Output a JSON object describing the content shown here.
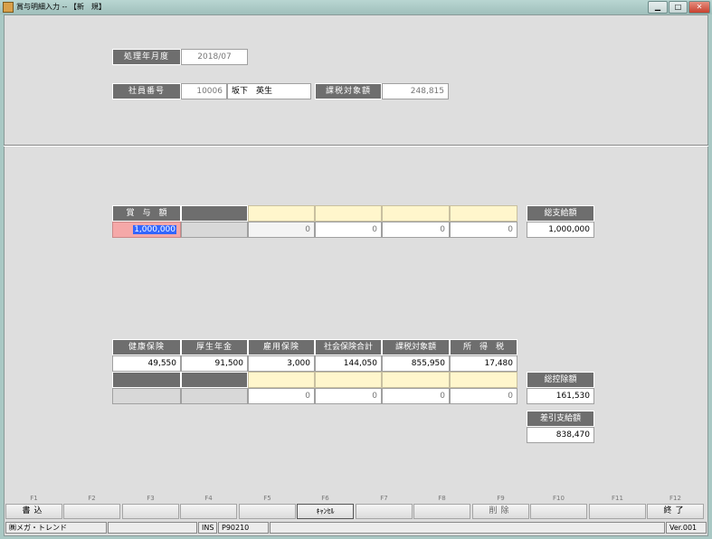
{
  "window": {
    "title": "賞与明細入力 -- 【新　規】"
  },
  "header": {
    "period_label": "処理年月度",
    "period_value": "2018/07",
    "emp_label": "社員番号",
    "emp_no": "10006",
    "emp_name": "坂下　英生",
    "taxable_label": "課税対象額",
    "taxable_value": "248,815"
  },
  "payment": {
    "bonus_label": "賞　与　額",
    "bonus_value": "1,000,000",
    "extra_values": [
      "0",
      "0",
      "0",
      "0"
    ],
    "total_label": "総支給額",
    "total_value": "1,000,000"
  },
  "deduction": {
    "headers": [
      "健康保険",
      "厚生年金",
      "雇用保険",
      "社会保険合計",
      "課税対象額",
      "所　得　税"
    ],
    "values": [
      "49,550",
      "91,500",
      "3,000",
      "144,050",
      "855,950",
      "17,480"
    ],
    "extra_values": [
      "0",
      "0",
      "0",
      "0"
    ],
    "total_label": "総控除額",
    "total_value": "161,530",
    "net_label": "差引支給額",
    "net_value": "838,470"
  },
  "fkeys": [
    {
      "key": "F1",
      "label": "書込"
    },
    {
      "key": "F2",
      "label": ""
    },
    {
      "key": "F3",
      "label": ""
    },
    {
      "key": "F4",
      "label": ""
    },
    {
      "key": "F5",
      "label": ""
    },
    {
      "key": "F6",
      "label": "ｷｬﾝｾﾙ"
    },
    {
      "key": "F7",
      "label": ""
    },
    {
      "key": "F8",
      "label": ""
    },
    {
      "key": "F9",
      "label": "削除"
    },
    {
      "key": "F10",
      "label": ""
    },
    {
      "key": "F11",
      "label": ""
    },
    {
      "key": "F12",
      "label": "終了"
    }
  ],
  "statusbar": {
    "company": "㈱メガ・トレンド",
    "mode": "INS",
    "program": "P90210",
    "version": "Ver.001"
  }
}
